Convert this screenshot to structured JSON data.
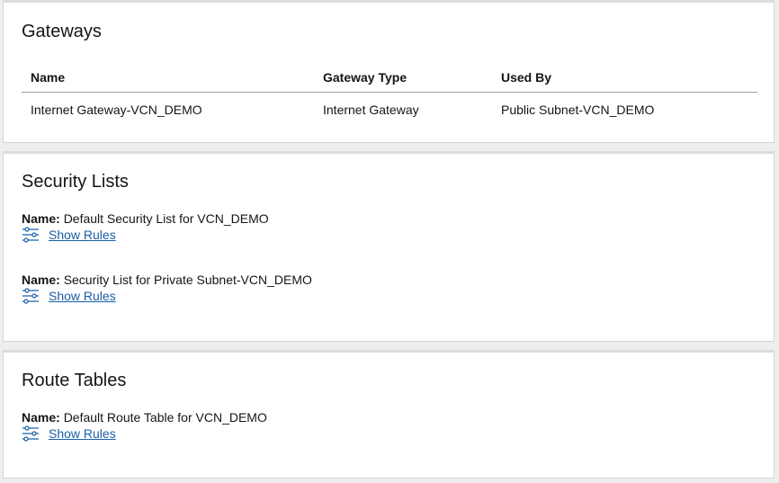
{
  "gateways": {
    "title": "Gateways",
    "columns": [
      "Name",
      "Gateway Type",
      "Used By"
    ],
    "rows": [
      [
        "Internet Gateway-VCN_DEMO",
        "Internet Gateway",
        "Public Subnet-VCN_DEMO"
      ]
    ]
  },
  "security_lists": {
    "title": "Security Lists",
    "items": [
      {
        "name_label": "Name:",
        "name": "Default Security List for VCN_DEMO",
        "link": "Show Rules",
        "icon": "sliders-icon"
      },
      {
        "name_label": "Name:",
        "name": "Security List for Private Subnet-VCN_DEMO",
        "link": "Show Rules",
        "icon": "sliders-icon"
      }
    ]
  },
  "route_tables": {
    "title": "Route Tables",
    "items": [
      {
        "name_label": "Name:",
        "name": "Default Route Table for VCN_DEMO",
        "link": "Show Rules",
        "icon": "sliders-icon"
      }
    ]
  },
  "colors": {
    "link": "#1a5fa7",
    "icon": "#1a5fa7"
  }
}
